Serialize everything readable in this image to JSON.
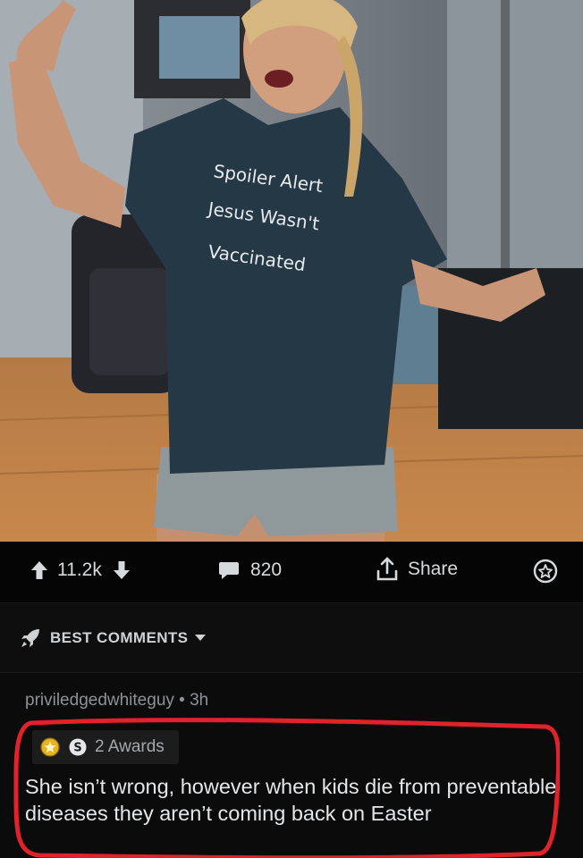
{
  "post": {
    "image": {
      "shirt_line_1": "Spoiler Alert",
      "shirt_line_2": "Jesus Wasn't",
      "shirt_line_3": "Vaccinated"
    },
    "actions": {
      "upvote_icon": "arrow-up-icon",
      "downvote_icon": "arrow-down-icon",
      "vote_count": "11.2k",
      "comment_icon": "comment-bubble-icon",
      "comment_count": "820",
      "share_icon": "share-icon",
      "share_label": "Share",
      "award_icon": "award-icon"
    }
  },
  "sort": {
    "icon": "rocket-icon",
    "label": "BEST COMMENTS",
    "caret_icon": "caret-down-icon"
  },
  "comment": {
    "author": "priviledgedwhiteguy",
    "separator": "•",
    "age": "3h",
    "awards_label": "2 Awards",
    "award_icons": [
      "gold-award-icon",
      "silver-award-icon"
    ],
    "body": "She isn’t wrong, however when kids die from preventable diseases they aren’t coming back on Easter",
    "highlight_color": "#e0222a"
  },
  "colors": {
    "background": "#000000",
    "text": "#d7dadc",
    "meta": "#8e9296"
  }
}
